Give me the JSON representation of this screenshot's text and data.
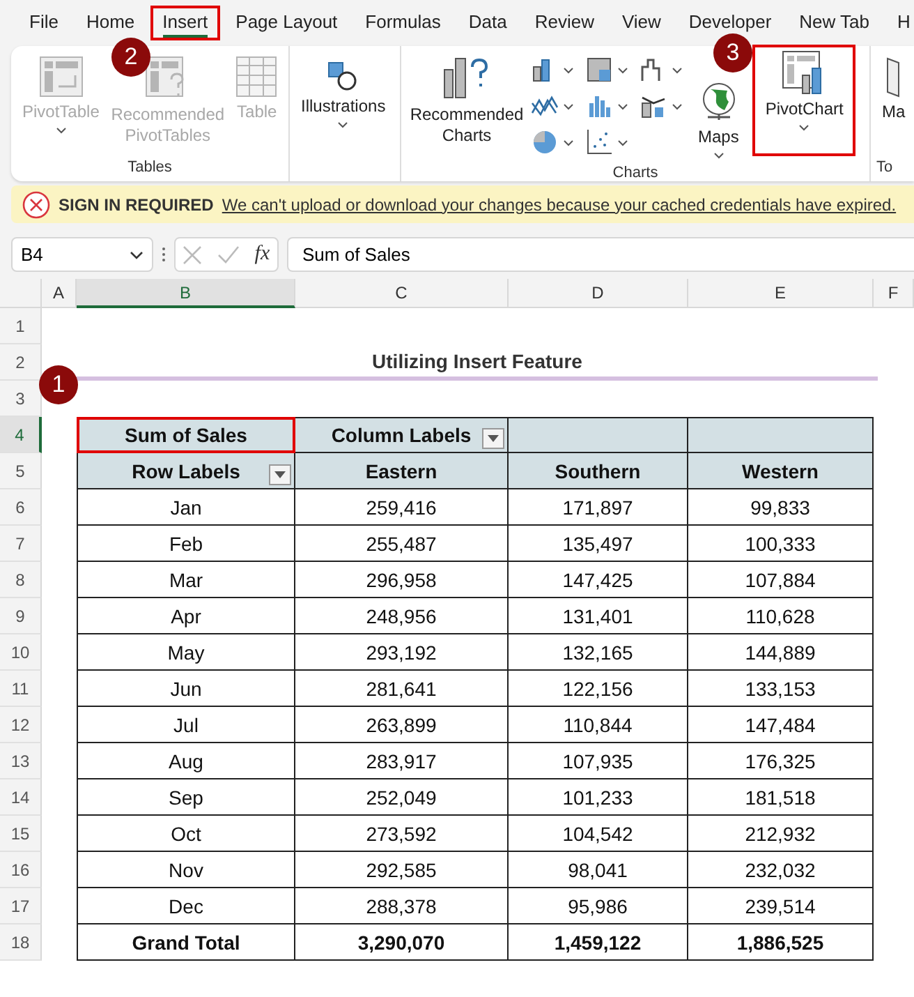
{
  "ribbon_tabs": [
    {
      "label": "File",
      "selected": false,
      "highlighted": false
    },
    {
      "label": "Home",
      "selected": false,
      "highlighted": false
    },
    {
      "label": "Insert",
      "selected": true,
      "highlighted": true,
      "callout": "2"
    },
    {
      "label": "Page Layout",
      "selected": false,
      "highlighted": false
    },
    {
      "label": "Formulas",
      "selected": false,
      "highlighted": false
    },
    {
      "label": "Data",
      "selected": false,
      "highlighted": false
    },
    {
      "label": "Review",
      "selected": false,
      "highlighted": false
    },
    {
      "label": "View",
      "selected": false,
      "highlighted": false
    },
    {
      "label": "Developer",
      "selected": false,
      "highlighted": false
    },
    {
      "label": "New Tab",
      "selected": false,
      "highlighted": false
    },
    {
      "label": "H",
      "selected": false,
      "highlighted": false
    }
  ],
  "tables_group": {
    "label": "Tables",
    "buttons": [
      {
        "label": "PivotTable",
        "disabled": true,
        "dropdown": true
      },
      {
        "label": "Recommended PivotTables",
        "disabled": true,
        "dropdown": false
      },
      {
        "label": "Table",
        "disabled": true,
        "dropdown": false
      }
    ]
  },
  "illustrations_group": {
    "button": "Illustrations"
  },
  "charts_group": {
    "label": "Charts",
    "recommended": "Recommended Charts",
    "maps": "Maps",
    "pivot_chart": {
      "label": "PivotChart",
      "highlighted": true,
      "callout": "3"
    }
  },
  "tours_group": {
    "button": "Ma",
    "label": "To"
  },
  "notice": {
    "title": "SIGN IN REQUIRED",
    "message": "We can't upload or download your changes because your cached credentials have expired."
  },
  "formula_bar": {
    "name_box": "B4",
    "fx": "fx",
    "formula": "Sum of Sales"
  },
  "columns": [
    {
      "label": "A",
      "selected": false
    },
    {
      "label": "B",
      "selected": true
    },
    {
      "label": "C",
      "selected": false
    },
    {
      "label": "D",
      "selected": false
    },
    {
      "label": "E",
      "selected": false
    },
    {
      "label": "F",
      "selected": false
    }
  ],
  "row_numbers": [
    {
      "label": "1",
      "selected": false
    },
    {
      "label": "2",
      "selected": false
    },
    {
      "label": "3",
      "selected": false
    },
    {
      "label": "4",
      "selected": true
    },
    {
      "label": "5",
      "selected": false
    },
    {
      "label": "6",
      "selected": false
    },
    {
      "label": "7",
      "selected": false
    },
    {
      "label": "8",
      "selected": false
    },
    {
      "label": "9",
      "selected": false
    },
    {
      "label": "10",
      "selected": false
    },
    {
      "label": "11",
      "selected": false
    },
    {
      "label": "12",
      "selected": false
    },
    {
      "label": "13",
      "selected": false
    },
    {
      "label": "14",
      "selected": false
    },
    {
      "label": "15",
      "selected": false
    },
    {
      "label": "16",
      "selected": false
    },
    {
      "label": "17",
      "selected": false
    },
    {
      "label": "18",
      "selected": false
    }
  ],
  "sheet_title": "Utilizing Insert Feature",
  "pivot": {
    "callout": "1",
    "corner": {
      "label": "Sum of Sales",
      "highlighted": true
    },
    "column_labels": "Column Labels",
    "row_labels": "Row Labels",
    "regions": [
      "Eastern",
      "Southern",
      "Western"
    ],
    "rows": [
      [
        "Jan",
        "259,416",
        "171,897",
        "99,833"
      ],
      [
        "Feb",
        "255,487",
        "135,497",
        "100,333"
      ],
      [
        "Mar",
        "296,958",
        "147,425",
        "107,884"
      ],
      [
        "Apr",
        "248,956",
        "131,401",
        "110,628"
      ],
      [
        "May",
        "293,192",
        "132,165",
        "144,889"
      ],
      [
        "Jun",
        "281,641",
        "122,156",
        "133,153"
      ],
      [
        "Jul",
        "263,899",
        "110,844",
        "147,484"
      ],
      [
        "Aug",
        "283,917",
        "107,935",
        "176,325"
      ],
      [
        "Sep",
        "252,049",
        "101,233",
        "181,518"
      ],
      [
        "Oct",
        "273,592",
        "104,542",
        "212,932"
      ],
      [
        "Nov",
        "292,585",
        "98,041",
        "232,032"
      ],
      [
        "Dec",
        "288,378",
        "95,986",
        "239,514"
      ]
    ],
    "total": [
      "Grand Total",
      "3,290,070",
      "1,459,122",
      "1,886,525"
    ]
  }
}
